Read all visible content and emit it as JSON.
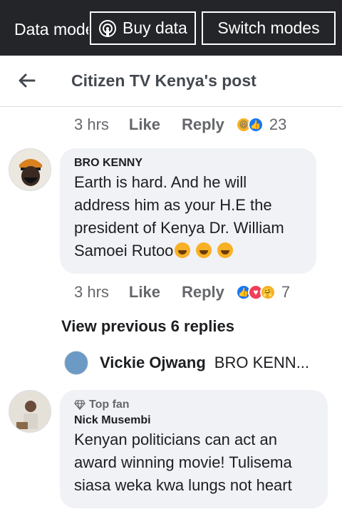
{
  "databar": {
    "mode_label": "Data mode",
    "buy_label": "Buy data",
    "switch_label": "Switch modes"
  },
  "header": {
    "title": "Citizen TV Kenya's post"
  },
  "prev_actions": {
    "time": "3 hrs",
    "like": "Like",
    "reply": "Reply",
    "count": "23",
    "reactions": [
      "haha",
      "like"
    ]
  },
  "comment1": {
    "author": "BRO KENNY",
    "text": "Earth is hard. And he will address him as your H.E the president of Kenya Dr. William Samoei Rutoo",
    "actions": {
      "time": "3 hrs",
      "like": "Like",
      "reply": "Reply",
      "count": "7",
      "reactions": [
        "like",
        "love",
        "care"
      ]
    }
  },
  "view_previous": "View previous 6 replies",
  "reply_preview": {
    "author": "Vickie Ojwang",
    "text": "BRO KENN..."
  },
  "comment2": {
    "badge": "Top fan",
    "author": "Nick Musembi",
    "text": "Kenyan politicians can act an award winning movie! Tulisema siasa weka kwa lungs not heart"
  },
  "colors": {
    "databar_bg": "#232529",
    "bubble_bg": "#f0f2f5",
    "like_blue": "#1877f2",
    "love_red": "#f33e58",
    "haha_yellow": "#f7b125"
  }
}
